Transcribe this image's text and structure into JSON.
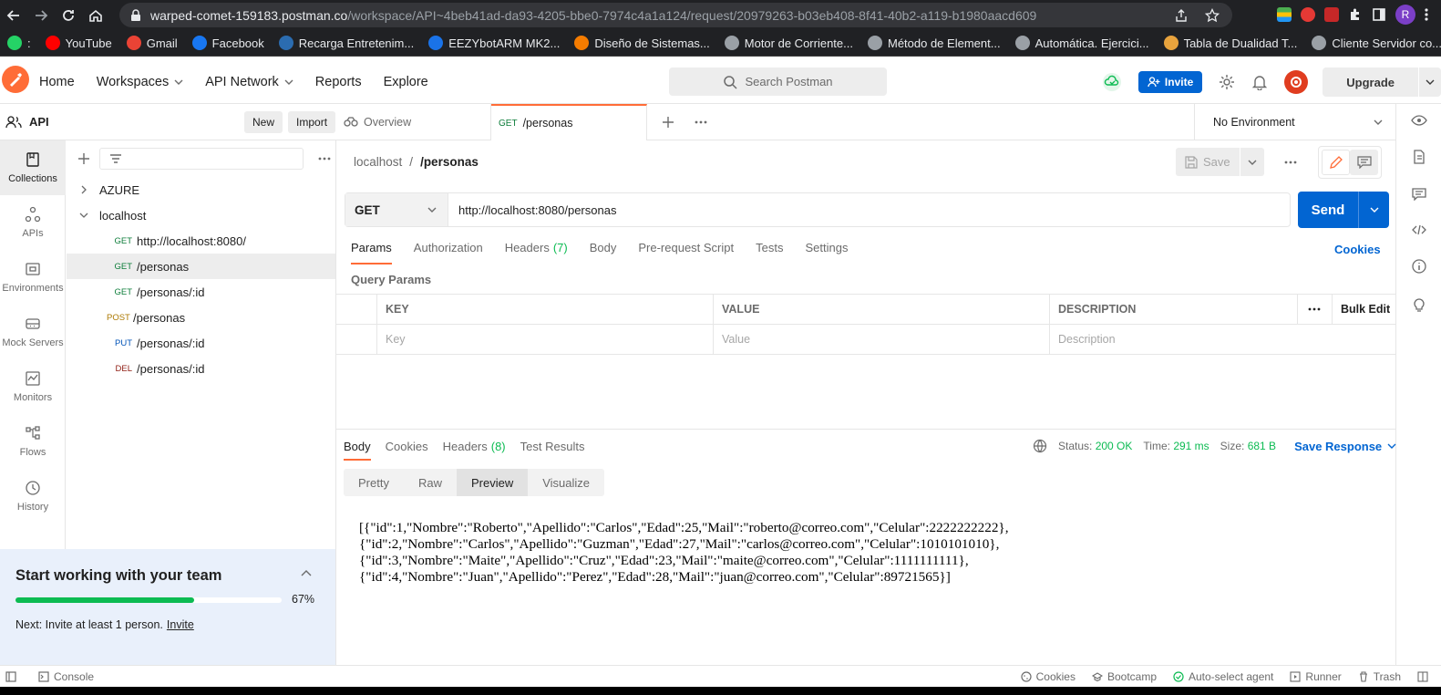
{
  "browser": {
    "url_host": "warped-comet-159183.postman.co",
    "url_path": "/workspace/API~4beb41ad-da93-4205-bbe0-7974c4a1a124/request/20979263-b03eb408-8f41-40b2-a119-b1980aacd609",
    "profile_initial": "R",
    "bookmarks": [
      {
        "label": "YouTube",
        "color": "#ff0000"
      },
      {
        "label": "Gmail",
        "color": "#ea4335"
      },
      {
        "label": "Facebook",
        "color": "#1877f2"
      },
      {
        "label": "Recarga Entretenim...",
        "color": "#2b6cb0"
      },
      {
        "label": "EEZYbotARM MK2...",
        "color": "#1a73e8"
      },
      {
        "label": "Diseño de Sistemas...",
        "color": "#f57c00"
      },
      {
        "label": "Motor de Corriente...",
        "color": "#9aa0a6"
      },
      {
        "label": "Método de Element...",
        "color": "#9aa0a6"
      },
      {
        "label": "Automática. Ejercici...",
        "color": "#9aa0a6"
      },
      {
        "label": "Tabla de Dualidad T...",
        "color": "#e8a33d"
      },
      {
        "label": "Cliente Servidor co...",
        "color": "#9aa0a6"
      }
    ]
  },
  "header": {
    "nav": [
      {
        "label": "Home",
        "caret": false
      },
      {
        "label": "Workspaces",
        "caret": true
      },
      {
        "label": "API Network",
        "caret": true
      },
      {
        "label": "Reports",
        "caret": false
      },
      {
        "label": "Explore",
        "caret": false
      }
    ],
    "search_placeholder": "Search Postman",
    "invite_label": "Invite",
    "upgrade_label": "Upgrade"
  },
  "workspace": {
    "name": "API",
    "new_label": "New",
    "import_label": "Import"
  },
  "rail": [
    {
      "label": "Collections",
      "icon": "collections-icon",
      "active": true
    },
    {
      "label": "APIs",
      "icon": "apis-icon",
      "active": false
    },
    {
      "label": "Environments",
      "icon": "environments-icon",
      "active": false
    },
    {
      "label": "Mock Servers",
      "icon": "mock-servers-icon",
      "active": false
    },
    {
      "label": "Monitors",
      "icon": "monitors-icon",
      "active": false
    },
    {
      "label": "Flows",
      "icon": "flows-icon",
      "active": false
    },
    {
      "label": "History",
      "icon": "history-icon",
      "active": false
    }
  ],
  "tree": [
    {
      "type": "folder",
      "label": "AZURE",
      "expanded": false
    },
    {
      "type": "folder",
      "label": "localhost",
      "expanded": true
    },
    {
      "type": "request",
      "method": "GET",
      "label": "http://localhost:8080/",
      "selected": false
    },
    {
      "type": "request",
      "method": "GET",
      "label": "/personas",
      "selected": true
    },
    {
      "type": "request",
      "method": "GET",
      "label": "/personas/:id",
      "selected": false
    },
    {
      "type": "request",
      "method": "POST",
      "label": "/personas",
      "selected": false
    },
    {
      "type": "request",
      "method": "PUT",
      "label": "/personas/:id",
      "selected": false
    },
    {
      "type": "request",
      "method": "DEL",
      "label": "/personas/:id",
      "selected": false
    }
  ],
  "team_panel": {
    "title": "Start working with your team",
    "progress": 0.67,
    "progress_label": "67%",
    "next_text": "Next: Invite at least 1 person.",
    "next_link": "Invite"
  },
  "tabs": [
    {
      "label": "Overview",
      "method": "",
      "active": false
    },
    {
      "label": "/personas",
      "method": "GET",
      "active": true
    }
  ],
  "environment": "No Environment",
  "request": {
    "breadcrumb_parent": "localhost",
    "breadcrumb_current": "/personas",
    "save_label": "Save",
    "method": "GET",
    "url": "http://localhost:8080/personas",
    "send_label": "Send",
    "tabs": [
      {
        "label": "Params",
        "count": "",
        "active": true
      },
      {
        "label": "Authorization",
        "count": "",
        "active": false
      },
      {
        "label": "Headers",
        "count": "(7)",
        "active": false
      },
      {
        "label": "Body",
        "count": "",
        "active": false
      },
      {
        "label": "Pre-request Script",
        "count": "",
        "active": false
      },
      {
        "label": "Tests",
        "count": "",
        "active": false
      },
      {
        "label": "Settings",
        "count": "",
        "active": false
      }
    ],
    "cookies_label": "Cookies",
    "query_params_title": "Query Params",
    "columns": [
      "KEY",
      "VALUE",
      "DESCRIPTION"
    ],
    "bulk_edit_label": "Bulk Edit",
    "placeholders": [
      "Key",
      "Value",
      "Description"
    ]
  },
  "response": {
    "tabs": [
      {
        "label": "Body",
        "count": "",
        "active": true
      },
      {
        "label": "Cookies",
        "count": "",
        "active": false
      },
      {
        "label": "Headers",
        "count": "(8)",
        "active": false
      },
      {
        "label": "Test Results",
        "count": "",
        "active": false
      }
    ],
    "status_label": "Status:",
    "status_value": "200 OK",
    "time_label": "Time:",
    "time_value": "291 ms",
    "size_label": "Size:",
    "size_value": "681 B",
    "save_response_label": "Save Response",
    "formats": [
      {
        "label": "Pretty",
        "active": false
      },
      {
        "label": "Raw",
        "active": false
      },
      {
        "label": "Preview",
        "active": true
      },
      {
        "label": "Visualize",
        "active": false
      }
    ],
    "body_lines": [
      "[{\"id\":1,\"Nombre\":\"Roberto\",\"Apellido\":\"Carlos\",\"Edad\":25,\"Mail\":\"roberto@correo.com\",\"Celular\":2222222222},",
      "{\"id\":2,\"Nombre\":\"Carlos\",\"Apellido\":\"Guzman\",\"Edad\":27,\"Mail\":\"carlos@correo.com\",\"Celular\":1010101010},",
      "{\"id\":3,\"Nombre\":\"Maite\",\"Apellido\":\"Cruz\",\"Edad\":23,\"Mail\":\"maite@correo.com\",\"Celular\":1111111111},",
      "{\"id\":4,\"Nombre\":\"Juan\",\"Apellido\":\"Perez\",\"Edad\":28,\"Mail\":\"juan@correo.com\",\"Celular\":89721565}]"
    ]
  },
  "statusbar": {
    "console_label": "Console",
    "items": [
      "Cookies",
      "Bootcamp",
      "Auto-select agent",
      "Runner",
      "Trash"
    ]
  },
  "colors": {
    "accent": "#ff6c37",
    "primary": "#0265d2",
    "success": "#0cbb52"
  }
}
